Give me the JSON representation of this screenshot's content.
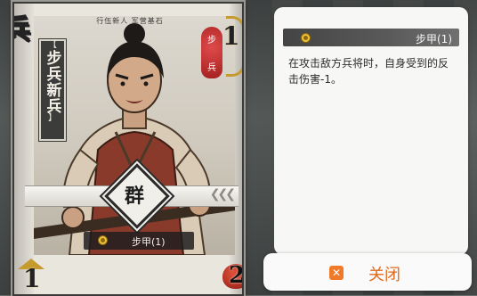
{
  "card": {
    "suit_char": "兵",
    "subtitle": "行伍新人 军营基石",
    "name_bracket_top": "【",
    "name": "步兵新兵",
    "name_bracket_bot": "】",
    "type_top": "步",
    "type_bottom": "兵",
    "attack": "1",
    "faction": "群",
    "skill_label": "步甲(1)",
    "hp": "1",
    "durability": "2",
    "banner_arrows": "❮❮❮"
  },
  "panel": {
    "skill_title": "步甲(1)",
    "description": "在攻击敌方兵将时，自身受到的反击伤害-1。"
  },
  "close": {
    "icon": "✕",
    "label": "关闭"
  },
  "colors": {
    "accent_orange": "#e06a1c",
    "badge_red": "#c0302d",
    "gold": "#c59a2e"
  }
}
